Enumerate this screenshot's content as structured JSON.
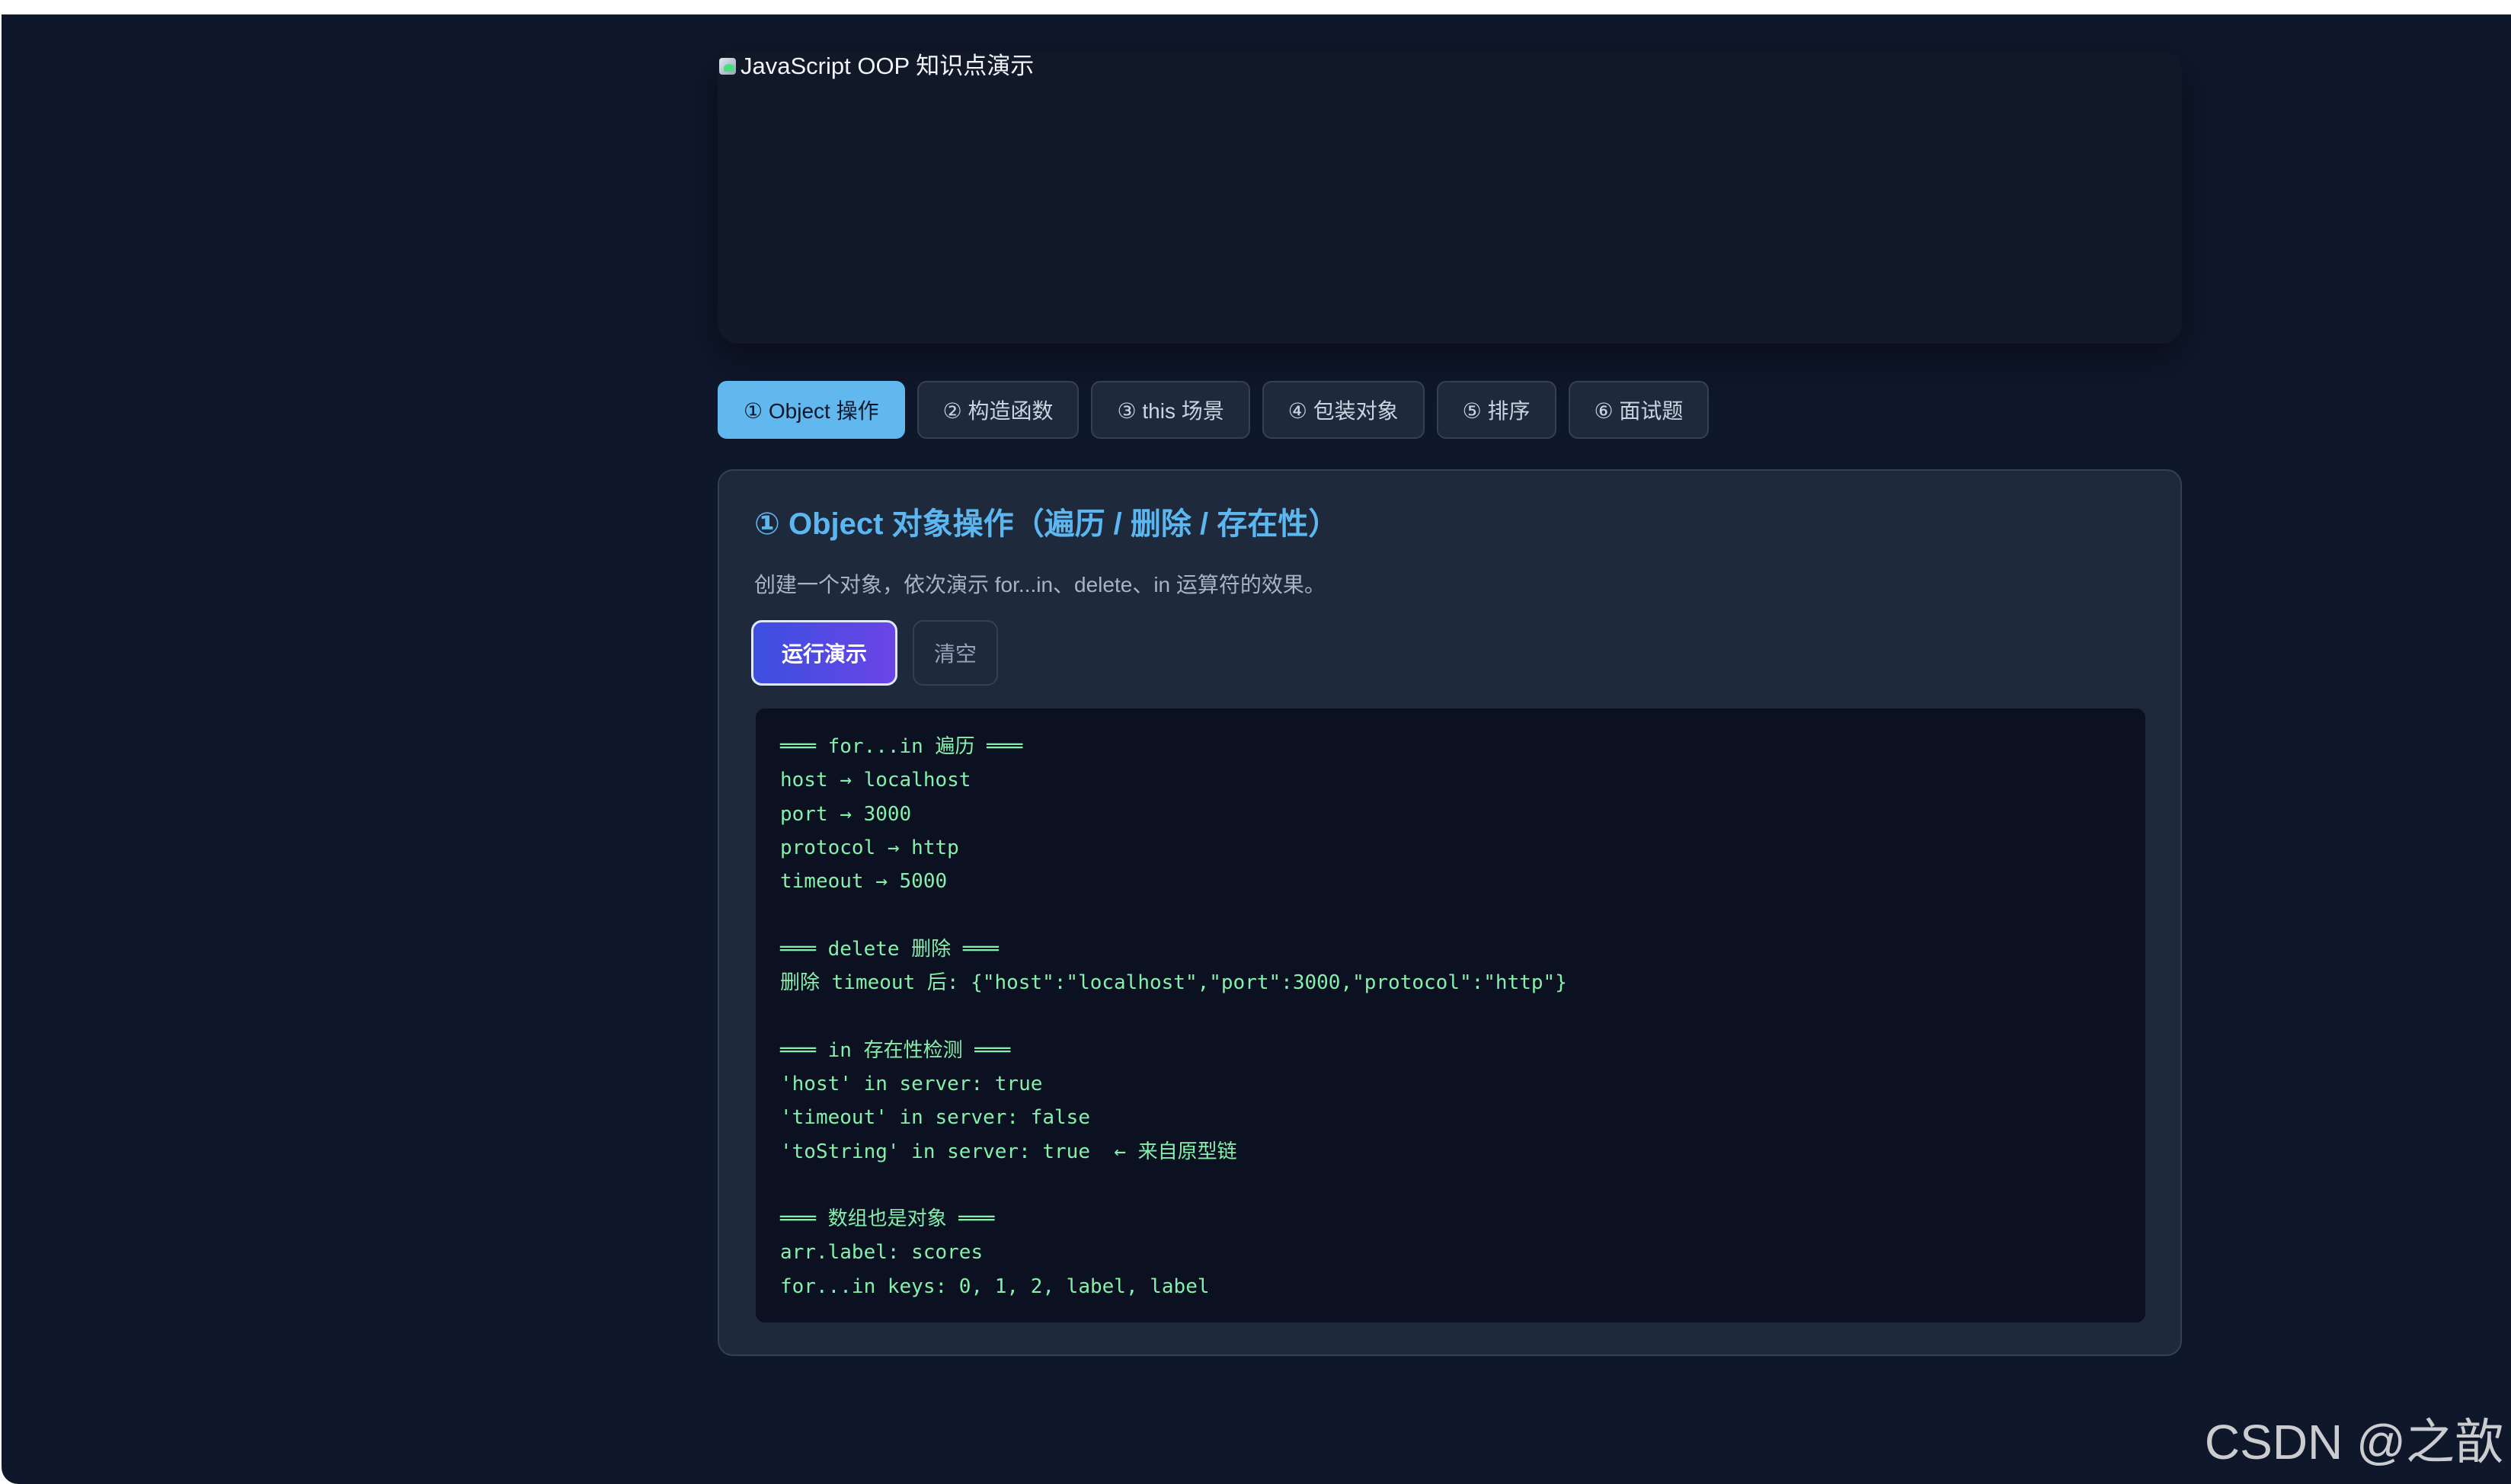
{
  "hero": {
    "image_alt": "JavaScript OOP 知识点演示"
  },
  "tabs": [
    {
      "label": "① Object 操作",
      "active": true
    },
    {
      "label": "② 构造函数",
      "active": false
    },
    {
      "label": "③ this 场景",
      "active": false
    },
    {
      "label": "④ 包装对象",
      "active": false
    },
    {
      "label": "⑤ 排序",
      "active": false
    },
    {
      "label": "⑥ 面试题",
      "active": false
    }
  ],
  "panel": {
    "title": "① Object 对象操作（遍历 / 删除 / 存在性）",
    "description": "创建一个对象，依次演示 for...in、delete、in 运算符的效果。",
    "run_button": "运行演示",
    "clear_button": "清空",
    "output_lines": [
      "═══ for...in 遍历 ═══",
      "host → localhost",
      "port → 3000",
      "protocol → http",
      "timeout → 5000",
      "",
      "═══ delete 删除 ═══",
      "删除 timeout 后: {\"host\":\"localhost\",\"port\":3000,\"protocol\":\"http\"}",
      "",
      "═══ in 存在性检测 ═══",
      "'host' in server: true",
      "'timeout' in server: false",
      "'toString' in server: true  ← 来自原型链",
      "",
      "═══ 数组也是对象 ═══",
      "arr.label: scores",
      "for...in keys: 0, 1, 2, label, label"
    ]
  },
  "watermark": "CSDN @之歆",
  "colors": {
    "page_bg": "#0f172a",
    "card_bg": "#1e293b",
    "accent_blue": "#60b8ef",
    "output_green": "#86efac",
    "run_gradient_start": "#3b4fe0",
    "run_gradient_end": "#6a45e6"
  }
}
